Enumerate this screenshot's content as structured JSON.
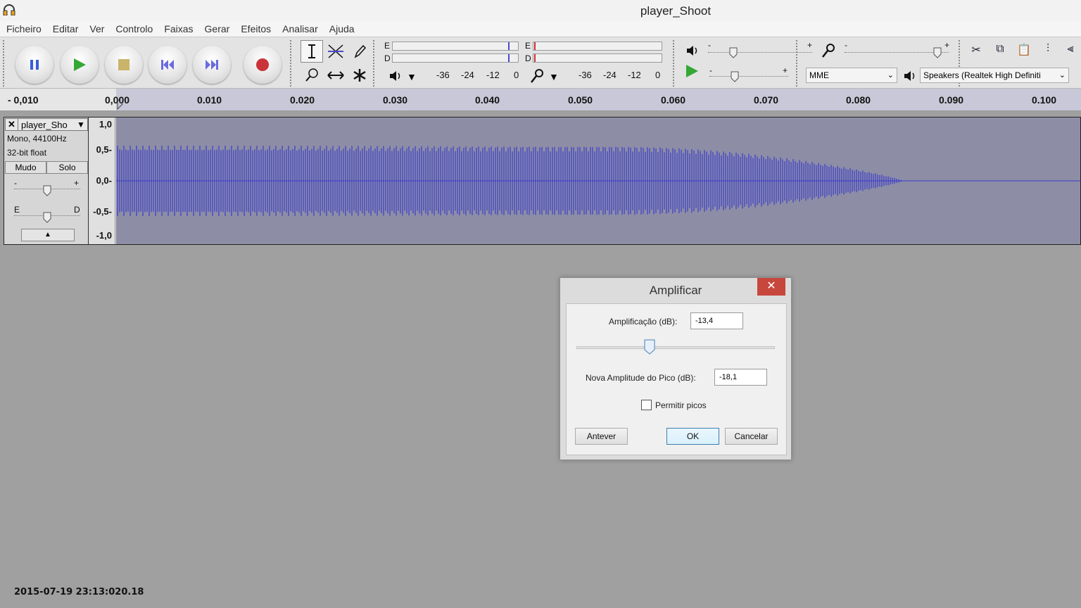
{
  "window": {
    "title": "player_Shoot",
    "app_icon": "headphones-icon"
  },
  "menu": [
    "Ficheiro",
    "Editar",
    "Ver",
    "Controlo",
    "Faixas",
    "Gerar",
    "Efeitos",
    "Analisar",
    "Ajuda"
  ],
  "transport": {
    "buttons": [
      "pause",
      "play",
      "stop",
      "skip-to-start",
      "skip-to-end",
      "record"
    ],
    "colors": {
      "pause": "#3a5ed8",
      "play": "#34a834",
      "stop": "#c9b46a",
      "skip": "#6a6ae0",
      "record": "#c9333a"
    }
  },
  "tools": [
    "selection-tool",
    "envelope-tool",
    "draw-tool",
    "zoom-tool",
    "timeshift-tool",
    "multi-tool"
  ],
  "meters": {
    "playback_channels": [
      "E",
      "D"
    ],
    "record_channels": [
      "E",
      "D"
    ],
    "playback_scale": [
      "-36",
      "-24",
      "-12",
      "0"
    ],
    "record_scale": [
      "-36",
      "-24",
      "-12",
      "0"
    ]
  },
  "mixer": {
    "minus": "-",
    "plus": "+"
  },
  "device": {
    "host": "MME",
    "output": "Speakers (Realtek High Definiti"
  },
  "ruler": {
    "ticks": [
      "- 0,010",
      "0,000",
      "0.010",
      "0.020",
      "0.030",
      "0.040",
      "0.050",
      "0.060",
      "0.070",
      "0.080",
      "0.090",
      "0.100"
    ]
  },
  "track": {
    "name": "player_Sho",
    "close": "✕",
    "format": "Mono, 44100Hz",
    "sample": "32-bit float",
    "mute": "Mudo",
    "solo": "Solo",
    "gain_minus": "-",
    "gain_plus": "+",
    "pan_left": "E",
    "pan_right": "D",
    "collapse": "▲",
    "scale": [
      "1,0",
      "0,5-",
      "0,0-",
      "-0,5-",
      "-1,0"
    ],
    "wave_color": "#3a3acc"
  },
  "dialog": {
    "title": "Amplificar",
    "close": "✕",
    "amplification_label": "Amplificação (dB):",
    "amplification_value": "-13,4",
    "slider_level": 0.37,
    "peak_label": "Nova Amplitude do Pico (dB):",
    "peak_value": "-18,1",
    "allow_clipping_label": "Permitir picos",
    "allow_clipping_checked": false,
    "preview_button": "Antever",
    "ok_button": "OK",
    "cancel_button": "Cancelar"
  },
  "timestamp": "2015-07-19 23:13:020.18"
}
